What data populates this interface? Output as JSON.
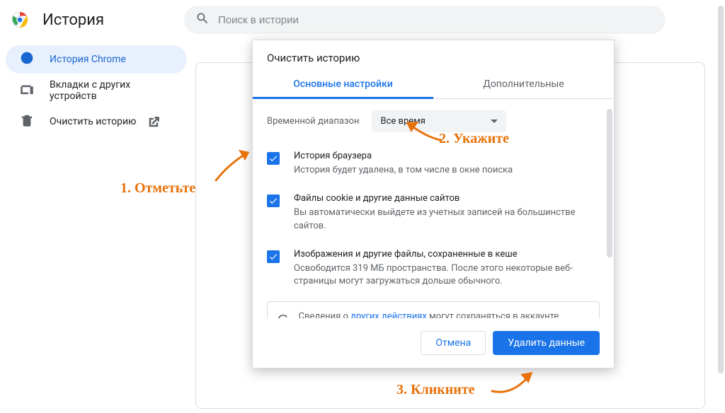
{
  "header": {
    "title": "История",
    "search_placeholder": "Поиск в истории"
  },
  "sidebar": {
    "items": [
      {
        "label": "История Chrome",
        "icon": "clock"
      },
      {
        "label": "Вкладки с других устройств",
        "icon": "devices"
      },
      {
        "label": "Очистить историю",
        "icon": "trash",
        "external": true
      }
    ]
  },
  "dialog": {
    "title": "Очистить историю",
    "tabs": {
      "basic": "Основные настройки",
      "advanced": "Дополнительные"
    },
    "time_range": {
      "label": "Временной диапазон",
      "value": "Все время"
    },
    "checks": [
      {
        "title": "История браузера",
        "desc": "История будет удалена, в том числе в окне поиска",
        "checked": true
      },
      {
        "title": "Файлы cookie и другие данные сайтов",
        "desc": "Вы автоматически выйдете из учетных записей на большинстве сайтов.",
        "checked": true
      },
      {
        "title": "Изображения и другие файлы, сохраненные в кеше",
        "desc": "Освободится 319 МБ пространства. После этого некоторые веб-страницы могут загружаться дольше обычного.",
        "checked": true
      }
    ],
    "info": {
      "prefix": "Сведения о ",
      "link": "других действиях",
      "suffix": " могут сохраняться в аккаунте Google, если вы в него вошли. Эти данные можно удалить в"
    },
    "actions": {
      "cancel": "Отмена",
      "confirm": "Удалить данные"
    }
  },
  "annotations": {
    "step1": "1. Отметьте",
    "step2": "2. Укажите",
    "step3": "3. Кликните"
  }
}
